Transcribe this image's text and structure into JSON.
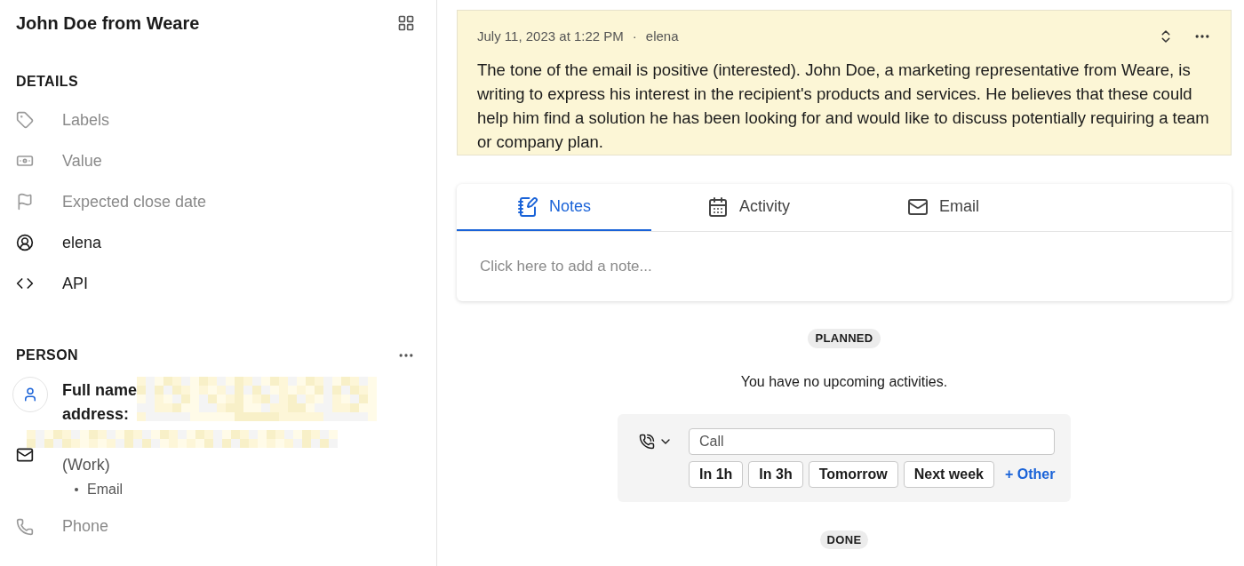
{
  "deal": {
    "title": "John Doe from Weare"
  },
  "details": {
    "heading": "DETAILS",
    "items": [
      {
        "kind": "tag",
        "label": "Labels",
        "filled": false
      },
      {
        "kind": "money",
        "label": "Value",
        "filled": false
      },
      {
        "kind": "flag",
        "label": "Expected close date",
        "filled": false
      },
      {
        "kind": "user",
        "label": "elena",
        "filled": true
      },
      {
        "kind": "code",
        "label": "API",
        "filled": true
      }
    ]
  },
  "person": {
    "heading": "PERSON",
    "name_label": "Full name",
    "address_label": "address:",
    "email_type": "(Work)",
    "email_bullet": "Email",
    "phone_label": "Phone"
  },
  "note": {
    "date": "July 11, 2023 at 1:22 PM",
    "separator": "·",
    "author": "elena",
    "text": "The tone of the email is positive (interested). John Doe, a marketing representative from Weare, is writing to express his interest in the recipient's products and services. He believes that these could help him find a solution he has been looking for and would like to discuss potentially requiring a team or company plan."
  },
  "tabs": [
    {
      "kind": "notes",
      "label": "Notes",
      "selected": true
    },
    {
      "kind": "activity",
      "label": "Activity",
      "selected": false
    },
    {
      "kind": "email",
      "label": "Email",
      "selected": false
    }
  ],
  "note_input": {
    "placeholder": "Click here to add a note..."
  },
  "planned": {
    "badge": "PLANNED",
    "message": "You have no upcoming activities.",
    "activity_value": "Call",
    "quick_buttons": [
      "In 1h",
      "In 3h",
      "Tomorrow",
      "Next week"
    ],
    "other_link": "+ Other"
  },
  "done": {
    "badge": "DONE"
  }
}
